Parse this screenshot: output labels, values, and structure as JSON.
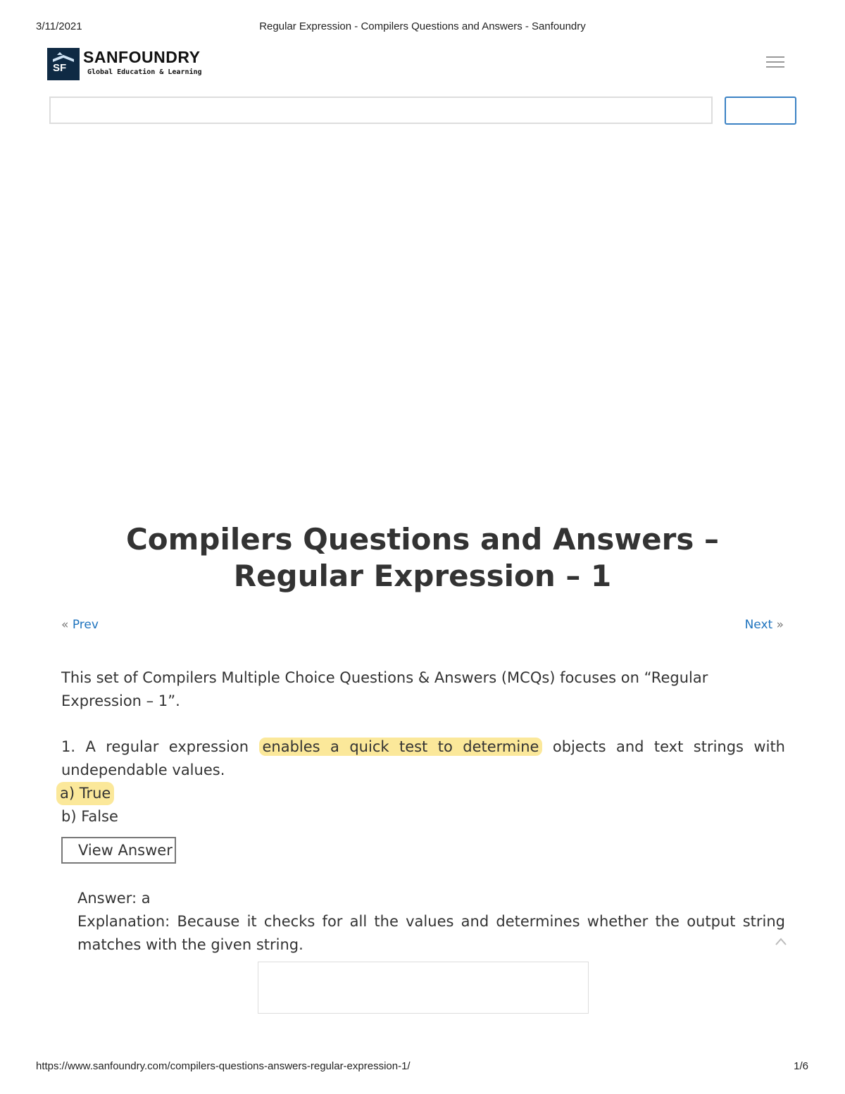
{
  "print_header": {
    "date": "3/11/2021",
    "title": "Regular Expression - Compilers Questions and Answers - Sanfoundry"
  },
  "logo": {
    "badge_text": "SF",
    "brand": "SANFOUNDRY",
    "tagline": "Global Education & Learning",
    "colors": {
      "badge_bg": "#0f2a44"
    }
  },
  "search": {
    "placeholder": "",
    "button_label": ""
  },
  "article": {
    "title": "Compilers Questions and Answers – Regular Expression – 1",
    "prev_arrow": "«",
    "prev_label": "Prev",
    "next_label": "Next",
    "next_arrow": "»",
    "intro": "This set of Compilers Multiple Choice Questions & Answers (MCQs) focuses on “Regular Expression – 1”.",
    "question": {
      "number": "1.",
      "text_before": "A regular expression",
      "highlight": "enables a quick test to determine",
      "text_after": "objects and text strings with undependable values.",
      "options": [
        "a) True",
        "b) False"
      ]
    },
    "view_answer_label": "View Answer",
    "answer": "Answer: a",
    "explanation": "Explanation: Because it checks for all the values and determines whether the output string matches with the given string."
  },
  "print_footer": {
    "url": "https://www.sanfoundry.com/compilers-questions-answers-regular-expression-1/",
    "page": "1/6"
  },
  "colors": {
    "link": "#1e73be",
    "highlight": "#fbe89a",
    "search_button_border": "#3b82c4"
  },
  "icons": {
    "menu": "hamburger-menu-icon",
    "scroll_top": "chevron-up-icon"
  }
}
